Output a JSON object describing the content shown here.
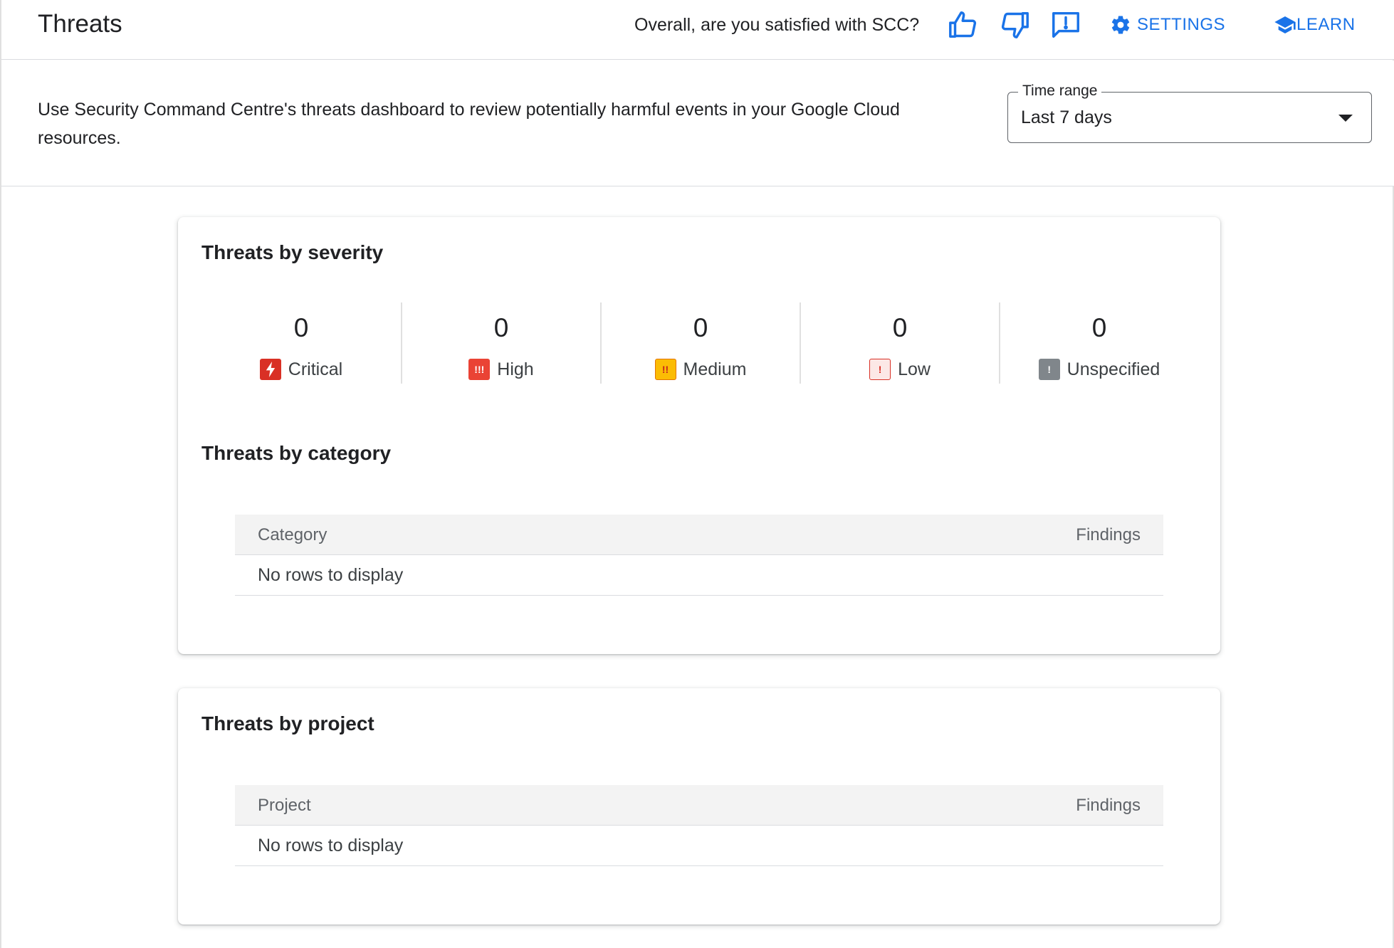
{
  "header": {
    "title": "Threats",
    "survey_question": "Overall, are you satisfied with SCC?",
    "thumbs_up_icon": "thumb-up-icon",
    "thumbs_down_icon": "thumb-down-icon",
    "feedback_icon": "feedback-icon",
    "settings_label": "SETTINGS",
    "learn_label": "LEARN"
  },
  "intro": {
    "description": "Use Security Command Centre's threats dashboard to review potentially harmful events in your Google Cloud resources.",
    "time_range": {
      "label": "Time range",
      "value": "Last 7 days"
    }
  },
  "severity_card": {
    "title": "Threats by severity",
    "items": [
      {
        "label": "Critical",
        "count": "0",
        "color": "#d93025",
        "icon": "critical-icon"
      },
      {
        "label": "High",
        "count": "0",
        "color": "#ea4335",
        "icon": "high-icon"
      },
      {
        "label": "Medium",
        "count": "0",
        "color": "#fbbc04",
        "icon": "medium-icon"
      },
      {
        "label": "Low",
        "count": "0",
        "color": "#fce8e6",
        "icon": "low-icon"
      },
      {
        "label": "Unspecified",
        "count": "0",
        "color": "#80868b",
        "icon": "unspecified-icon"
      }
    ],
    "category_title": "Threats by category",
    "category_table": {
      "columns": [
        "Category",
        "Findings"
      ],
      "empty_text": "No rows to display"
    }
  },
  "project_card": {
    "title": "Threats by project",
    "table": {
      "columns": [
        "Project",
        "Findings"
      ],
      "empty_text": "No rows to display"
    }
  },
  "colors": {
    "accent": "#1a73e8",
    "text": "#202124",
    "divider": "#dadce0"
  }
}
